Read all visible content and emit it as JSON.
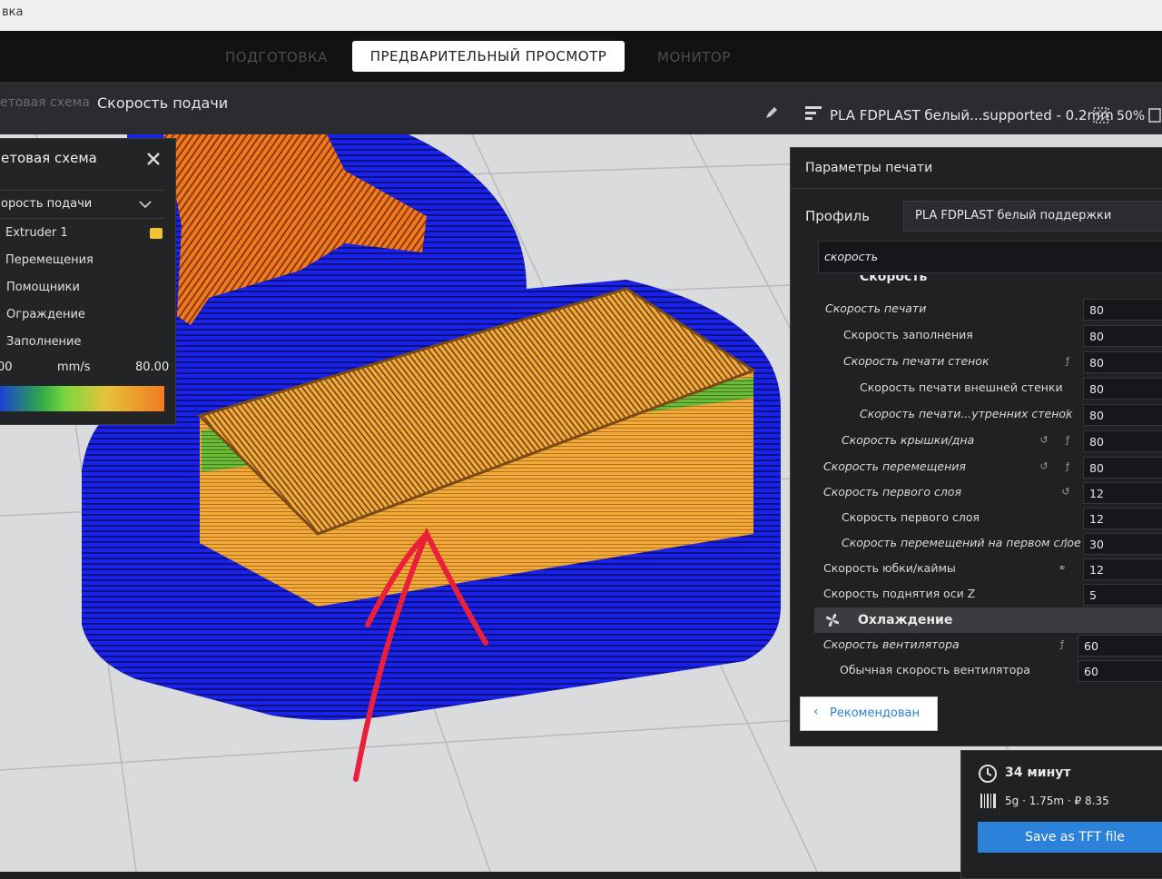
{
  "window": {
    "title_fragment": "вка"
  },
  "stages": [
    {
      "label": "ПОДГОТОВКА",
      "active": false
    },
    {
      "label": "ПРЕДВАРИТЕЛЬНЫЙ ПРОСМОТР",
      "active": true
    },
    {
      "label": "МОНИТОР",
      "active": false
    }
  ],
  "viewbar": {
    "color_scheme_label": "етовая схема",
    "color_scheme_value": "Скорость подачи",
    "profile_summary": "PLA FDPLAST белый...supported - 0.2mm",
    "infill_percent": "50%",
    "edit_icon": "pencil-icon",
    "profile_icon": "sliders-icon",
    "infill_icon": "infill-icon"
  },
  "color_panel": {
    "title": "етовая схема",
    "close_icon": "close-icon",
    "dropdown_value": "орость подачи",
    "items": [
      {
        "label": "Extruder 1",
        "swatch": "#f2c230"
      },
      {
        "label": "Перемещения"
      },
      {
        "label": "Помощники"
      },
      {
        "label": "Ограждение"
      },
      {
        "label": "Заполнение"
      }
    ],
    "legend_min": "00",
    "legend_unit": "mm/s",
    "legend_max": "80.00",
    "gradient_colors": [
      "#1a3fd6",
      "#2ea84a",
      "#7bd640",
      "#e7c23a",
      "#f07a22"
    ]
  },
  "print_settings": {
    "title": "Параметры печати",
    "profile_label": "Профиль",
    "profile_value": "PLA FDPLAST белый поддержки",
    "search_value": "скорость",
    "section_speed": "Скорость",
    "rows": [
      {
        "label": "Скорость печати",
        "value": "80",
        "icons": []
      },
      {
        "label": "Скорость заполнения",
        "value": "80",
        "icons": []
      },
      {
        "label": "Скорость печати стенок",
        "value": "80",
        "icons": [
          "function-icon"
        ]
      },
      {
        "label": "Скорость печати внешней стенки",
        "value": "80",
        "icons": []
      },
      {
        "label": "Скорость печати...утренних стенок",
        "value": "80",
        "icons": [
          "function-icon"
        ]
      },
      {
        "label": "Скорость крышки/дна",
        "value": "80",
        "icons": [
          "reset-icon",
          "function-icon"
        ]
      },
      {
        "label": "Скорость перемещения",
        "value": "80",
        "icons": [
          "reset-icon",
          "function-icon"
        ]
      },
      {
        "label": "Скорость первого слоя",
        "value": "12",
        "icons": [
          "reset-icon"
        ]
      },
      {
        "label": "Скорость первого слоя",
        "value": "12",
        "icons": []
      },
      {
        "label": "Скорость перемещений на первом слое",
        "value": "30",
        "icons": [
          "function-icon"
        ]
      },
      {
        "label": "Скорость юбки/каймы",
        "value": "12",
        "icons": [
          "link-icon"
        ]
      },
      {
        "label": "Скорость поднятия оси Z",
        "value": "5",
        "icons": []
      }
    ],
    "section_cooling": "Охлаждение",
    "cooling_rows": [
      {
        "label": "Скорость вентилятора",
        "value": "60",
        "icons": [
          "function-icon"
        ]
      },
      {
        "label": "Обычная скорость вентилятора",
        "value": "60",
        "icons": []
      }
    ],
    "recommended_button": "Рекомендован"
  },
  "estimate": {
    "time": "34 минут",
    "material": "5g · 1.75m · ₽ 8.35",
    "save_button": "Save as TFT file"
  },
  "colors": {
    "accent": "#2a82da",
    "support_blue": "#1a22e8",
    "orange": "#f07a22",
    "yellow_orange": "#f3a83a",
    "green": "#6cba3a",
    "annotation_red": "#ea1f3a"
  }
}
